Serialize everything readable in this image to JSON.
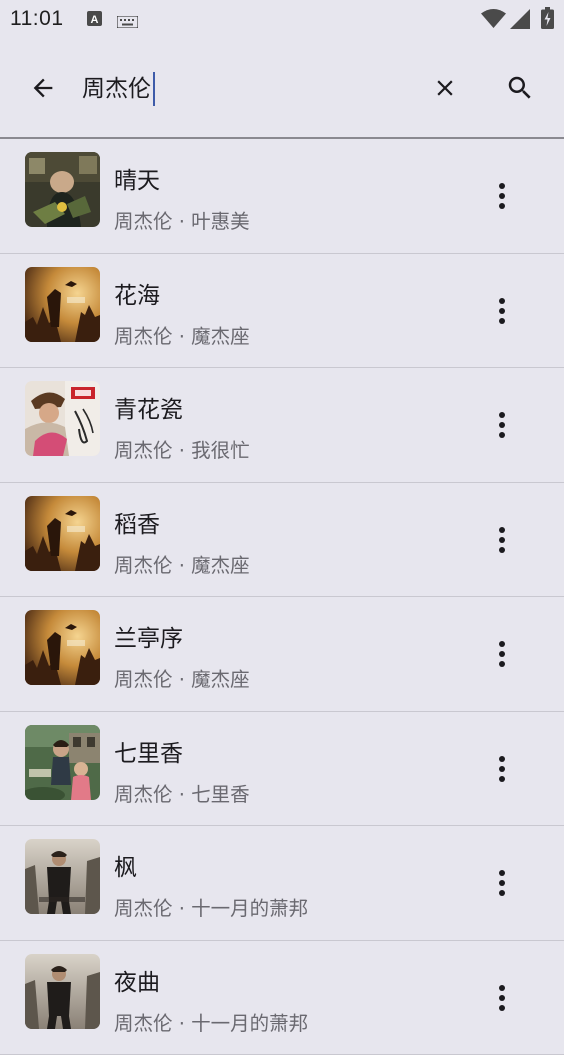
{
  "status_bar": {
    "time": "11:01",
    "icons": [
      "keyboard-a-icon",
      "keyboard-icon",
      "wifi-icon",
      "signal-icon",
      "battery-icon"
    ]
  },
  "search": {
    "query": "周杰伦",
    "back_icon": "arrow-back-icon",
    "clear_icon": "close-icon",
    "search_icon": "search-icon"
  },
  "songs": [
    {
      "title": "晴天",
      "subtitle": "周杰伦 · 叶惠美",
      "art": "album-art-ye-hui-mei"
    },
    {
      "title": "花海",
      "subtitle": "周杰伦 · 魔杰座",
      "art": "album-art-mo-jie-zuo"
    },
    {
      "title": "青花瓷",
      "subtitle": "周杰伦 · 我很忙",
      "art": "album-art-wo-hen-mang"
    },
    {
      "title": "稻香",
      "subtitle": "周杰伦 · 魔杰座",
      "art": "album-art-mo-jie-zuo"
    },
    {
      "title": "兰亭序",
      "subtitle": "周杰伦 · 魔杰座",
      "art": "album-art-mo-jie-zuo"
    },
    {
      "title": "七里香",
      "subtitle": "周杰伦 · 七里香",
      "art": "album-art-qi-li-xiang"
    },
    {
      "title": "枫",
      "subtitle": "周杰伦 · 十一月的萧邦",
      "art": "album-art-november-chopin"
    },
    {
      "title": "夜曲",
      "subtitle": "周杰伦 · 十一月的萧邦",
      "art": "album-art-november-chopin"
    }
  ],
  "more_icon": "more-vert-icon",
  "colors": {
    "background": "#e7e6ee",
    "caret": "#3e5ba9",
    "primary_text": "#1c1b1f",
    "secondary_text": "#6a6970"
  }
}
